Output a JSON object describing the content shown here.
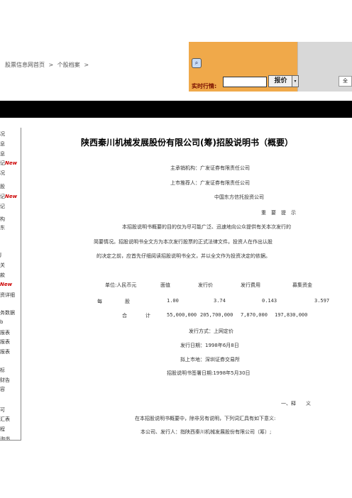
{
  "breadcrumb": {
    "home": "股票信息网首页",
    "sep": ">",
    "current": "个股档案",
    "sep2": ">"
  },
  "quote": {
    "label": "实时行情:",
    "button": "报价",
    "select_arrow": "▾",
    "right_text": "全"
  },
  "sidebar": {
    "items": [
      "况",
      "息",
      "息",
      "记",
      "New",
      "况",
      "股",
      "记",
      "New",
      "记",
      "构",
      "东",
      "J",
      "关",
      "款",
      "New",
      "资详细",
      "务数据",
      "b",
      "报表",
      "报表",
      "报表",
      "标",
      "财告",
      "容",
      "可",
      "汇表",
      "程",
      "询书"
    ]
  },
  "doc": {
    "title": "陕西秦川机械发展股份有限公司(筹)招股说明书（概要）",
    "lead_underwriter": "主承销机构：广发证券有限责任公司",
    "sponsor": "上市推荐人：广发证券有限责任公司",
    "sponsor2": "中国东方信托投资公司",
    "notice_title": "重　要　提　示",
    "notice_1": "本招股说明书概要的目的仅为尽可能广泛、迅速地向公众提供有关本次发行的",
    "notice_2": "简要情况。招股说明书全文方为本次发行股票的正式法律文件。投资人在作出认股",
    "notice_3": "的决定之前，应首先仔细阅读招股说明书全文，并以全文作为投资决定的依据。",
    "table": {
      "header": [
        "单位:人民币元",
        "面值",
        "发行价",
        "发行费用",
        "募集资金"
      ],
      "row1": [
        "每",
        "股",
        "1.00",
        "3.74",
        "0.143",
        "3.597"
      ],
      "row2": [
        "合",
        "计",
        "55,000,000",
        "205,700,000",
        "7,870,000",
        "197,830,000"
      ]
    },
    "method": "发行方式：上网定价",
    "issue_date": "发行日期：1998年6月8日",
    "listing": "拟上市地：深圳证券交易所",
    "sign_date": "招股说明书签署日期:1998年5月30日",
    "section": "一、释　　义",
    "def_intro": "在本招股说明书概要中，除非另有说明，下列词汇具有如下意义:",
    "def_1": "本公司、发行人：指陕西秦川机械发展股份有限公司（筹）;"
  }
}
